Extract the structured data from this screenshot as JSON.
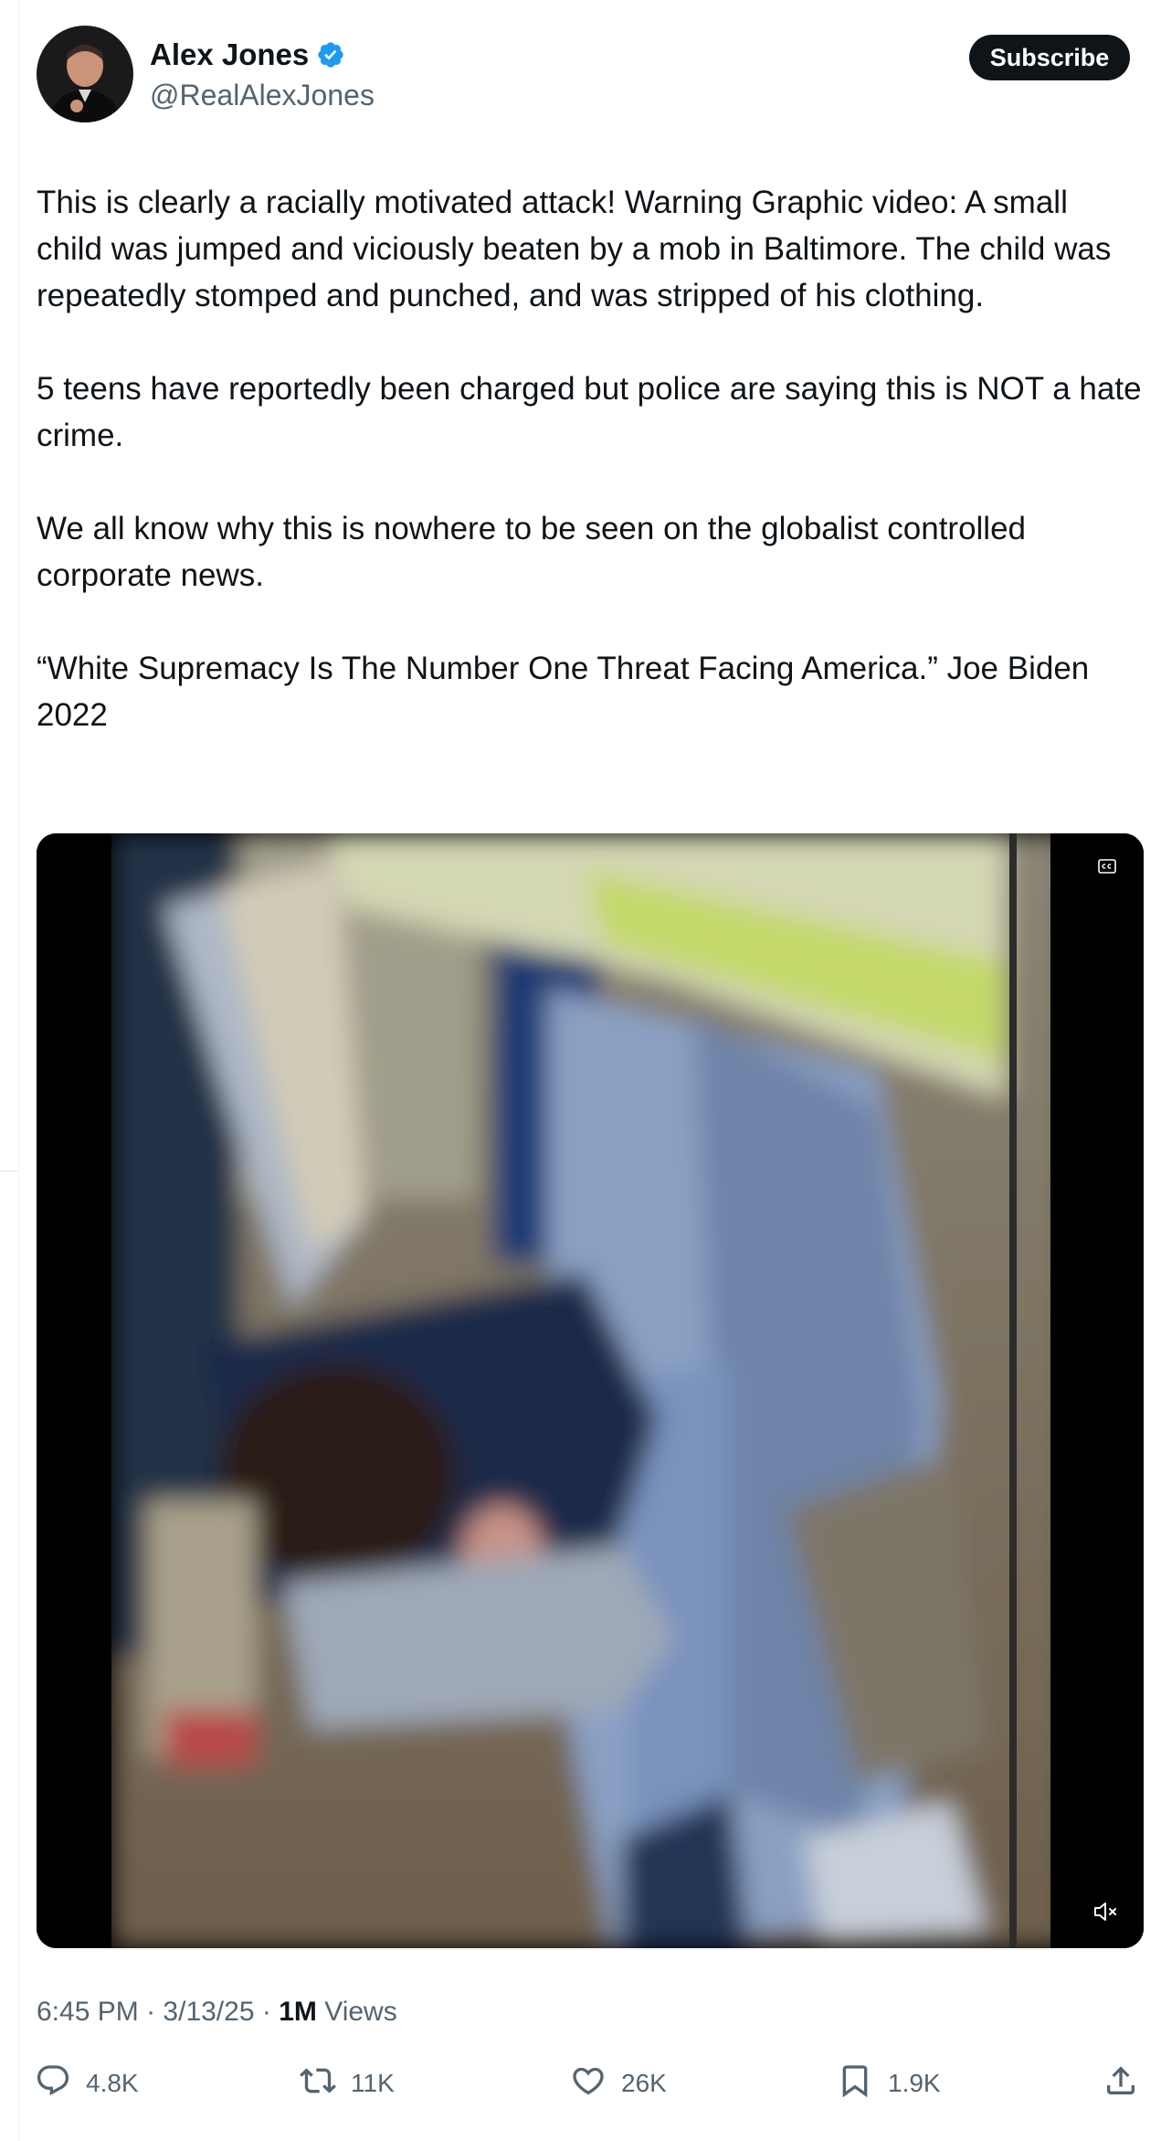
{
  "author": {
    "name": "Alex Jones",
    "handle": "@RealAlexJones",
    "verified": true
  },
  "subscribe_label": "Subscribe",
  "post": {
    "paragraphs": [
      "This is clearly a racially motivated attack! Warning Graphic video: A small child was jumped and viciously beaten by a mob in Baltimore. The child was repeatedly stomped and punched, and was stripped of his clothing.",
      "5 teens have reportedly been charged but police are saying this is NOT a hate crime.",
      "We all know why this is nowhere to be seen on the globalist controlled corporate news.",
      "“White Supremacy Is The Number One Threat Facing America.” Joe Biden 2022"
    ]
  },
  "video": {
    "cc_icon": "closed-captions-icon",
    "mute_icon": "speaker-muted-icon"
  },
  "meta": {
    "time": "6:45 PM",
    "date": "3/13/25",
    "views_count": "1M",
    "views_label": "Views",
    "separator": "·"
  },
  "actions": {
    "replies": "4.8K",
    "reposts": "11K",
    "likes": "26K",
    "bookmarks": "1.9K"
  },
  "colors": {
    "text": "#0f1419",
    "secondary": "#536471",
    "verified_blue": "#1d9bf0",
    "button_bg": "#0f1419"
  }
}
